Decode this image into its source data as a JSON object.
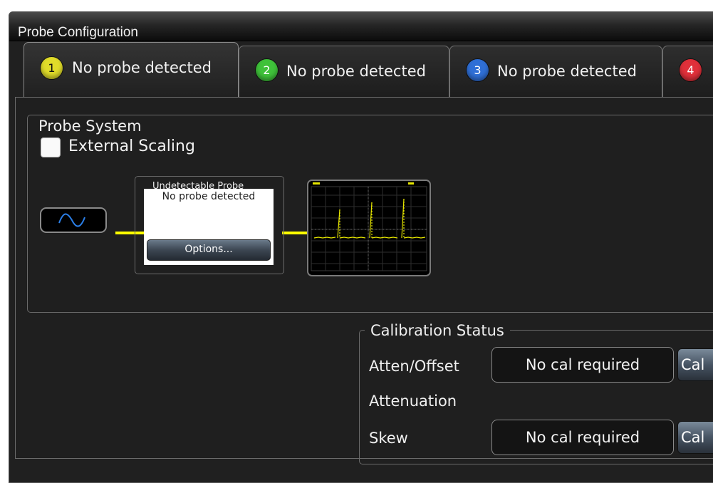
{
  "window": {
    "title": "Probe Configuration"
  },
  "tabs": [
    {
      "number": "1",
      "label": "No probe detected",
      "color": "#e0dc2a",
      "active": true
    },
    {
      "number": "2",
      "label": "No probe detected",
      "color": "#3fc23a",
      "active": false
    },
    {
      "number": "3",
      "label": "No probe detected",
      "color": "#2f6fd6",
      "active": false
    },
    {
      "number": "4",
      "label": "",
      "color": "#e0303a",
      "active": false
    }
  ],
  "probe_system": {
    "legend": "Probe System",
    "external_scaling_label": "External Scaling",
    "external_scaling_checked": false,
    "probe_group_legend": "Undetectable Probe",
    "probe_status": "No probe detected",
    "options_label": "Options..."
  },
  "calibration": {
    "legend": "Calibration Status",
    "rows": [
      {
        "label": "Atten/Offset",
        "status": "No cal required",
        "button": "Cal"
      },
      {
        "label": "Attenuation"
      },
      {
        "label": "Skew",
        "status": "No cal required",
        "button": "Cal"
      }
    ]
  },
  "icons": {
    "source": "sine-wave-icon",
    "scope": "oscilloscope-thumbnail",
    "accent": "#ffff00"
  }
}
